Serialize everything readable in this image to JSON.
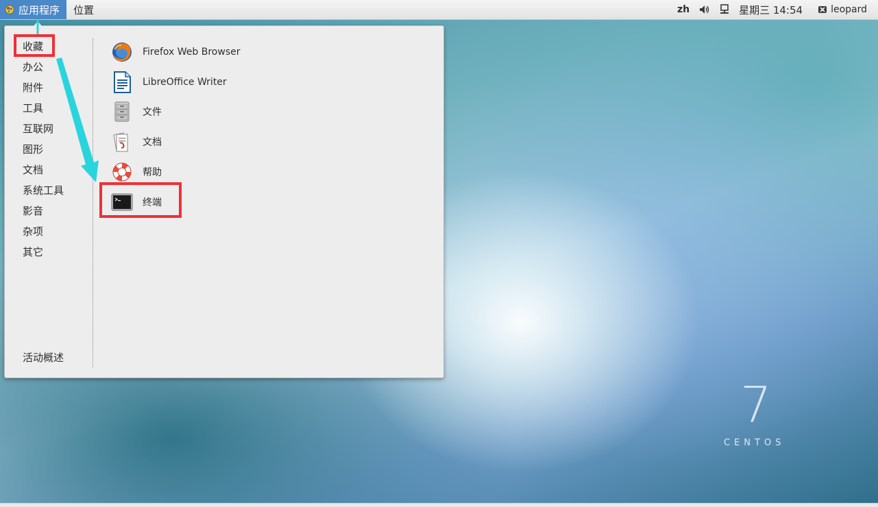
{
  "panel": {
    "apps_label": "应用程序",
    "places_label": "位置",
    "language": "zh",
    "datetime": "星期三 14:54",
    "user": "leopard",
    "icons": [
      "volume-icon",
      "network-icon",
      "user-icon"
    ]
  },
  "menu": {
    "categories": [
      "收藏",
      "办公",
      "附件",
      "工具",
      "互联网",
      "图形",
      "文档",
      "系统工具",
      "影音",
      "杂项",
      "其它"
    ],
    "activities": "活动概述",
    "selected_category": "收藏",
    "apps": [
      {
        "label": "Firefox Web Browser",
        "icon": "firefox-icon"
      },
      {
        "label": "LibreOffice Writer",
        "icon": "libreoffice-writer-icon"
      },
      {
        "label": "文件",
        "icon": "file-cabinet-icon"
      },
      {
        "label": "文档",
        "icon": "documents-icon"
      },
      {
        "label": "帮助",
        "icon": "lifebuoy-icon"
      },
      {
        "label": "终端",
        "icon": "terminal-icon"
      }
    ]
  },
  "branding": {
    "version": "7",
    "name": "CENTOS"
  },
  "colors": {
    "accent": "#4a88c8",
    "highlight": "#ee3037",
    "arrow": "#2ad4dc"
  }
}
